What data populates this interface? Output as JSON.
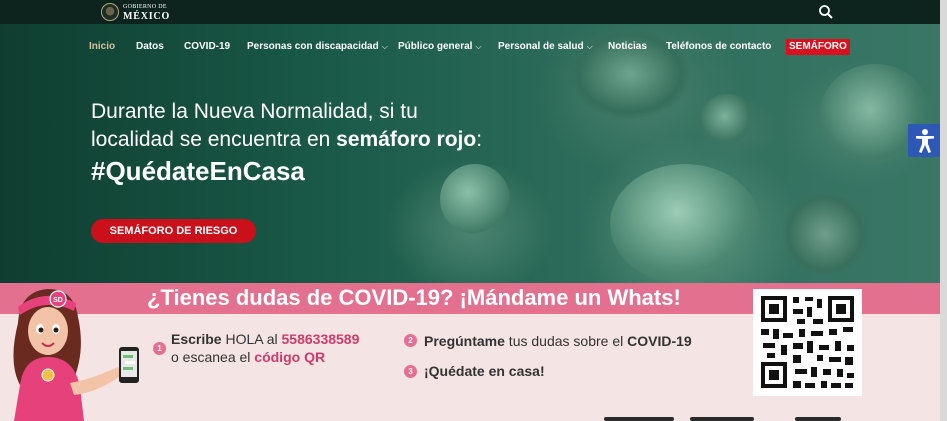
{
  "gov": {
    "logo_small": "GOBIERNO DE",
    "logo_big": "MÉXICO"
  },
  "nav": {
    "items": [
      {
        "label": "Inicio",
        "active": true,
        "dropdown": false
      },
      {
        "label": "Datos",
        "active": false,
        "dropdown": false
      },
      {
        "label": "COVID-19",
        "active": false,
        "dropdown": false
      },
      {
        "label": "Personas con discapacidad",
        "active": false,
        "dropdown": true
      },
      {
        "label": "Público general",
        "active": false,
        "dropdown": true
      },
      {
        "label": "Personal de salud",
        "active": false,
        "dropdown": true
      },
      {
        "label": "Noticias",
        "active": false,
        "dropdown": false
      },
      {
        "label": "Teléfonos de contacto",
        "active": false,
        "dropdown": false
      }
    ],
    "semaforo": "SEMÁFORO",
    "caret": "⌵"
  },
  "hero": {
    "line1": "Durante la Nueva Normalidad, si tu",
    "line2_prefix": "localidad se encuentra en ",
    "line2_bold": "semáforo rojo",
    "line2_suffix": ":",
    "hashtag": "#QuédateEnCasa",
    "cta": "SEMÁFORO DE RIESGO"
  },
  "whatsapp": {
    "title": "¿Tienes dudas de COVID-19? ¡Mándame un Whats!",
    "step1_bold": "Escribe",
    "step1_text": " HOLA al ",
    "step1_phone": "5586338589",
    "step1_line2": "o escanea el ",
    "step1_link": "código QR",
    "step2_bold": "Pregúntame",
    "step2_text": " tus dudas sobre el ",
    "step2_bold2": "COVID-19",
    "step3_bold": "¡Quédate en casa!",
    "numbers": [
      "1",
      "2",
      "3"
    ],
    "mascot_badge": "SD"
  },
  "icons": {
    "search": "search-icon",
    "accessibility": "accessibility-icon",
    "seal": "coat-of-arms-icon",
    "phone": "phone-icon",
    "qr": "qr-code-icon"
  },
  "colors": {
    "gov_bar": "#0c231e",
    "active_nav": "#d4c19c",
    "red": "#d9111e",
    "pink": "#e3708f",
    "pink_light": "#f4e4e3",
    "a11y_blue": "#2d58b5"
  }
}
